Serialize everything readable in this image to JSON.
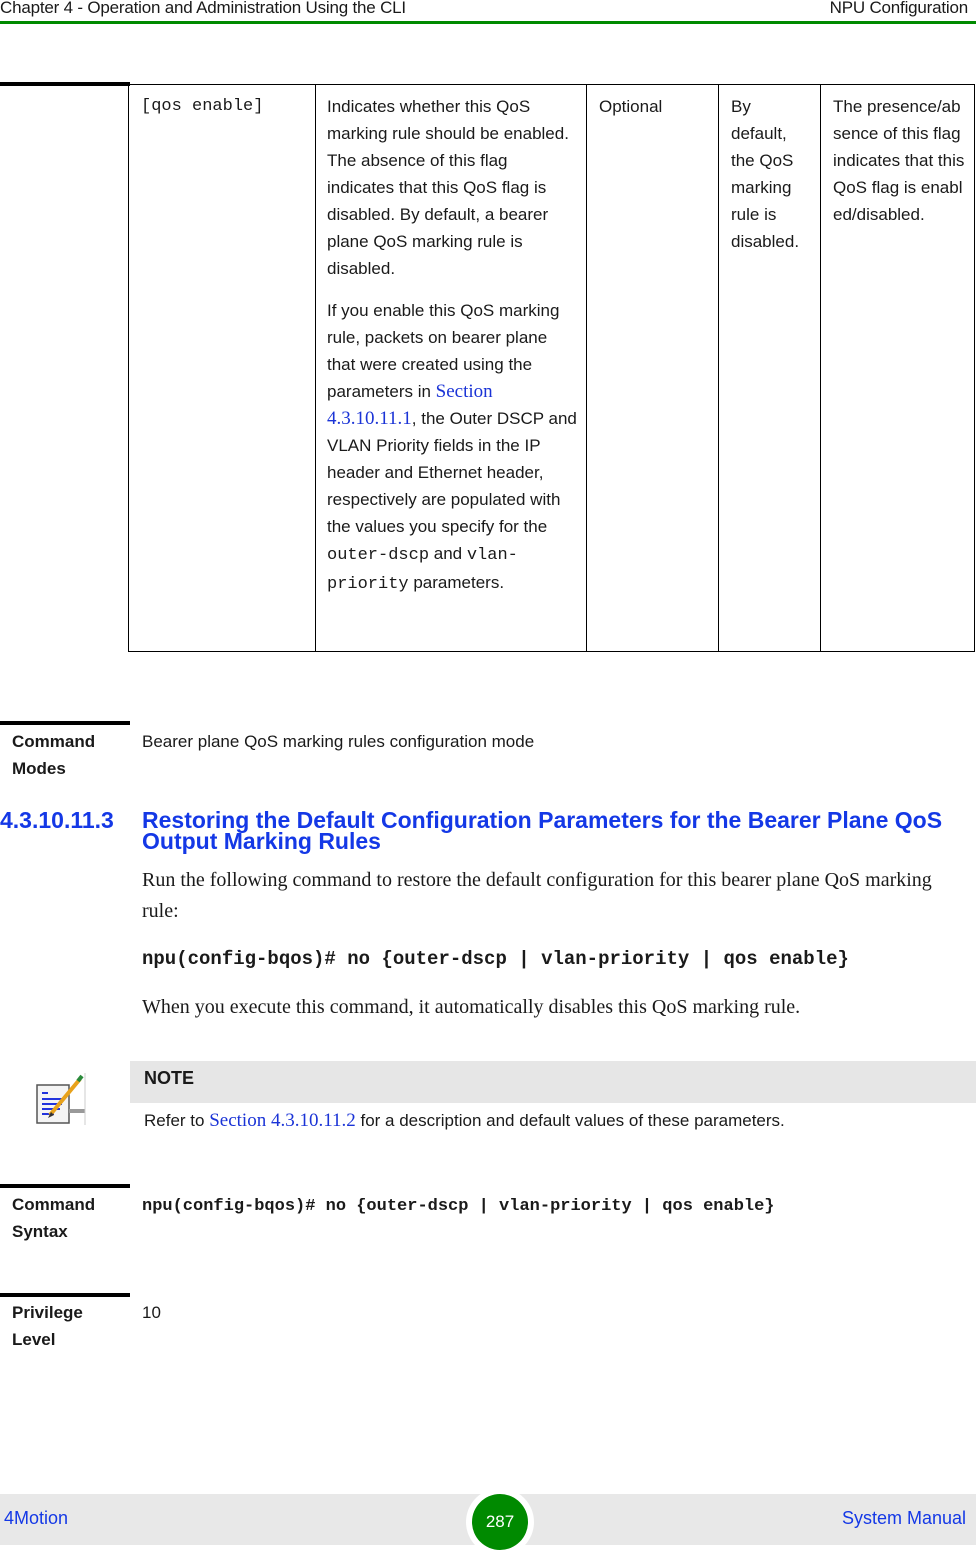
{
  "header": {
    "chapter": "Chapter 4 - Operation and Administration Using the CLI",
    "section": "NPU Configuration"
  },
  "param_table": {
    "row": {
      "parameter": "[qos enable]",
      "description_p1": "Indicates whether this QoS marking rule should be enabled. The absence of this flag indicates that this QoS flag is disabled. By default, a bearer plane QoS marking rule is disabled.",
      "description_p2_pre": "If you enable this QoS marking rule, packets on bearer plane that were created using the parameters in ",
      "description_p2_link": "Section 4.3.10.11.1",
      "description_p2_mid": ", the Outer DSCP and VLAN Priority fields in the IP header and Ethernet header, respectively are populated with the values you specify for the ",
      "description_p2_code1": "outer-dscp",
      "description_p2_and": " and ",
      "description_p2_code2": "vlan-priority",
      "description_p2_post": " parameters.",
      "presence": "Optional",
      "default": "By default, the QoS marking rule is disabled.",
      "possible_values": "The presence/absence of this flag indicates that this QoS flag is enabled/disabled."
    }
  },
  "command_modes": {
    "label": "Command Modes",
    "value": "Bearer plane QoS marking rules configuration mode"
  },
  "section": {
    "number": "4.3.10.11.3",
    "title": "Restoring the Default Configuration Parameters for the Bearer Plane QoS Output Marking Rules",
    "intro": "Run the following command to restore the default configuration for this bearer plane QoS marking rule:",
    "command": "npu(config-bqos)# no {outer-dscp | vlan-priority | qos enable}",
    "after": "When you execute this command, it automatically disables this QoS marking rule."
  },
  "note": {
    "icon": "note-pencil-icon",
    "title": "NOTE",
    "text_pre": "Refer to ",
    "link": "Section 4.3.10.11.2",
    "text_post": " for a description and default values of these parameters."
  },
  "command_syntax": {
    "label": "Command Syntax",
    "value": "npu(config-bqos)# no {outer-dscp | vlan-priority | qos enable}"
  },
  "privilege_level": {
    "label": "Privilege Level",
    "value": "10"
  },
  "footer": {
    "left": "4Motion",
    "page": "287",
    "right": "System Manual"
  }
}
